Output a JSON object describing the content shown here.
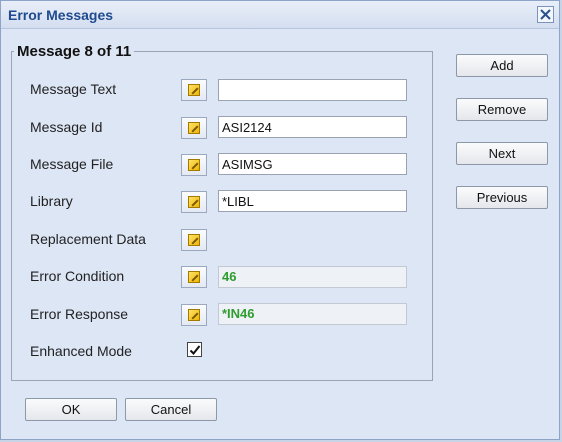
{
  "dialog": {
    "title": "Error Messages"
  },
  "group": {
    "legend": "Message 8 of 11"
  },
  "fields": {
    "message_text": {
      "label": "Message Text",
      "value": ""
    },
    "message_id": {
      "label": "Message Id",
      "value": "ASI2124"
    },
    "message_file": {
      "label": "Message File",
      "value": "ASIMSG"
    },
    "library": {
      "label": "Library",
      "value": "*LIBL"
    },
    "replacement_data": {
      "label": "Replacement Data"
    },
    "error_condition": {
      "label": "Error Condition",
      "value": "46"
    },
    "error_response": {
      "label": "Error Response",
      "value": "*IN46"
    },
    "enhanced_mode": {
      "label": "Enhanced Mode",
      "checked": true
    }
  },
  "side_buttons": {
    "add": "Add",
    "remove": "Remove",
    "next": "Next",
    "previous": "Previous"
  },
  "footer": {
    "ok": "OK",
    "cancel": "Cancel"
  },
  "colors": {
    "title": "#1f4a8f",
    "readonly_value": "#2e9d2e",
    "dialog_bg": "#dde6f5"
  },
  "icons": {
    "close": "close-icon",
    "prompt": "prompt-icon",
    "check": "checkmark-icon"
  }
}
